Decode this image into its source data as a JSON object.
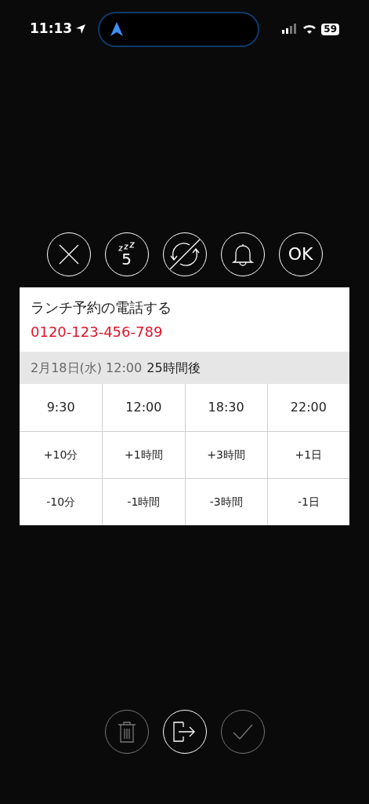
{
  "status_bar": {
    "time": "11:13",
    "battery": "59"
  },
  "actions": [
    {
      "kind": "close"
    },
    {
      "kind": "snooze",
      "label": "5"
    },
    {
      "kind": "no-repeat"
    },
    {
      "kind": "bell"
    },
    {
      "kind": "ok",
      "label": "OK"
    }
  ],
  "reminder": {
    "title": "ランチ予約の電話する",
    "phone": "0120-123-456-789",
    "date": "2月18日(水) 12:00",
    "relative": "25時間後"
  },
  "time_grid": [
    [
      "9:30",
      "12:00",
      "18:30",
      "22:00"
    ],
    [
      "+10分",
      "+1時間",
      "+3時間",
      "+1日"
    ],
    [
      "-10分",
      "-1時間",
      "-3時間",
      "-1日"
    ]
  ],
  "bottom_actions": [
    {
      "kind": "trash",
      "disabled": true
    },
    {
      "kind": "exit",
      "disabled": false
    },
    {
      "kind": "check",
      "disabled": true
    }
  ]
}
